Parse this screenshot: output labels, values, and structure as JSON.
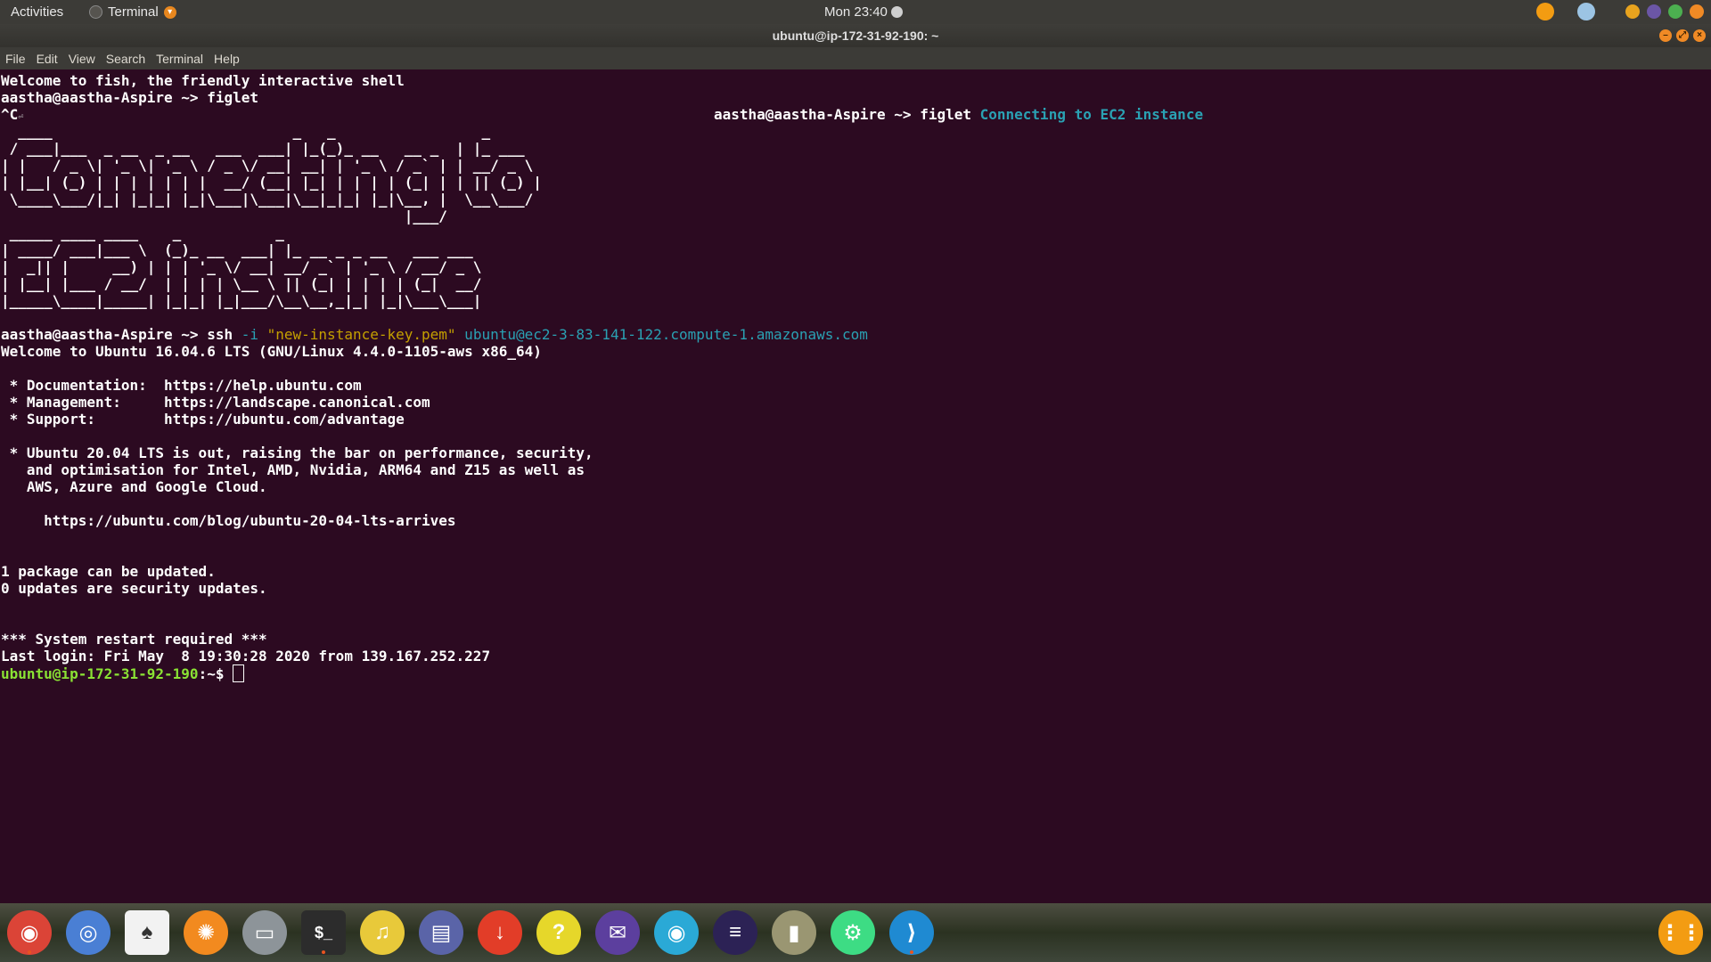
{
  "topbar": {
    "activities": "Activities",
    "app_name": "Terminal",
    "clock": "Mon 23:40"
  },
  "window": {
    "title": "ubuntu@ip-172-31-92-190: ~"
  },
  "menubar": {
    "items": [
      "File",
      "Edit",
      "View",
      "Search",
      "Terminal",
      "Help"
    ]
  },
  "terminal": {
    "welcome": "Welcome to fish, the friendly interactive shell",
    "prompt": "aastha@aastha-Aspire ~> ",
    "cmd1": "figlet",
    "ctrlc": "^C",
    "cmd2_prompt": "aastha@aastha-Aspire ~> ",
    "cmd2": "figlet ",
    "cmd2_arg": "Connecting to EC2 instance",
    "figlet_line1": [
      "  ____                            _   _                 _        ",
      " / ___|___  _ __  _ __   ___  ___| |_(_)_ __   __ _  | |_ ___  ",
      "| |   / _ \\| '_ \\| '_ \\ / _ \\/ __| __| | '_ \\ / _` | | __/ _ \\ ",
      "| |__| (_) | | | | | | |  __/ (__| |_| | | | | (_| | | || (_) |",
      " \\____\\___/|_| |_|_| |_|\\___|\\___|\\__|_|_| |_|\\__, |  \\__\\___/ ",
      "                                               |___/            "
    ],
    "figlet_line2": [
      " _____ ____ ____    _           _                        ",
      "| ____/ ___|___ \\  (_)_ __  ___| |_ __ _ _ __   ___ ___ ",
      "|  _|| |     __) | | | '_ \\/ __| __/ _` | '_ \\ / __/ _ \\",
      "| |__| |___ / __/  | | | | \\__ \\ || (_| | | | | (_|  __/",
      "|_____\\____|_____| |_|_| |_|___/\\__\\__,_|_| |_|\\___\\___|"
    ],
    "ssh_prompt": "aastha@aastha-Aspire ~> ",
    "ssh_cmd": "ssh",
    "ssh_flag": " -i ",
    "ssh_key": "\"new-instance-key.pem\"",
    "ssh_host": " ubuntu@ec2-3-83-141-122.compute-1.amazonaws.com",
    "output": [
      "Welcome to Ubuntu 16.04.6 LTS (GNU/Linux 4.4.0-1105-aws x86_64)",
      "",
      " * Documentation:  https://help.ubuntu.com",
      " * Management:     https://landscape.canonical.com",
      " * Support:        https://ubuntu.com/advantage",
      "",
      " * Ubuntu 20.04 LTS is out, raising the bar on performance, security,",
      "   and optimisation for Intel, AMD, Nvidia, ARM64 and Z15 as well as",
      "   AWS, Azure and Google Cloud.",
      "",
      "     https://ubuntu.com/blog/ubuntu-20-04-lts-arrives",
      "",
      "",
      "1 package can be updated.",
      "0 updates are security updates.",
      "",
      "",
      "*** System restart required ***",
      "Last login: Fri May  8 19:30:28 2020 from 139.167.252.227"
    ],
    "final_prompt_user": "ubuntu@ip-172-31-92-190",
    "final_prompt_suffix": ":~$ "
  },
  "dock": {
    "items": [
      {
        "name": "chrome-icon",
        "color": "#db4437"
      },
      {
        "name": "chromium-icon",
        "color": "#4a7fd4"
      },
      {
        "name": "games-icon",
        "color": "#f2f2f2"
      },
      {
        "name": "firefox-icon",
        "color": "#f28a1f"
      },
      {
        "name": "files-icon",
        "color": "#8d9499"
      },
      {
        "name": "terminal-icon",
        "color": "#2c2c2c"
      },
      {
        "name": "music-player-icon",
        "color": "#e8c93a"
      },
      {
        "name": "document-viewer-icon",
        "color": "#5a64a8"
      },
      {
        "name": "download-manager-icon",
        "color": "#e23d28"
      },
      {
        "name": "help-icon",
        "color": "#e6d72a"
      },
      {
        "name": "mail-icon",
        "color": "#5c3f9e"
      },
      {
        "name": "webcam-icon",
        "color": "#2aa9d6"
      },
      {
        "name": "eclipse-icon",
        "color": "#2c2255"
      },
      {
        "name": "archive-manager-icon",
        "color": "#9a9672"
      },
      {
        "name": "android-studio-icon",
        "color": "#3ddc84"
      },
      {
        "name": "vscode-icon",
        "color": "#1f8ad2"
      }
    ],
    "apps_grid_color": "#f39c12"
  }
}
